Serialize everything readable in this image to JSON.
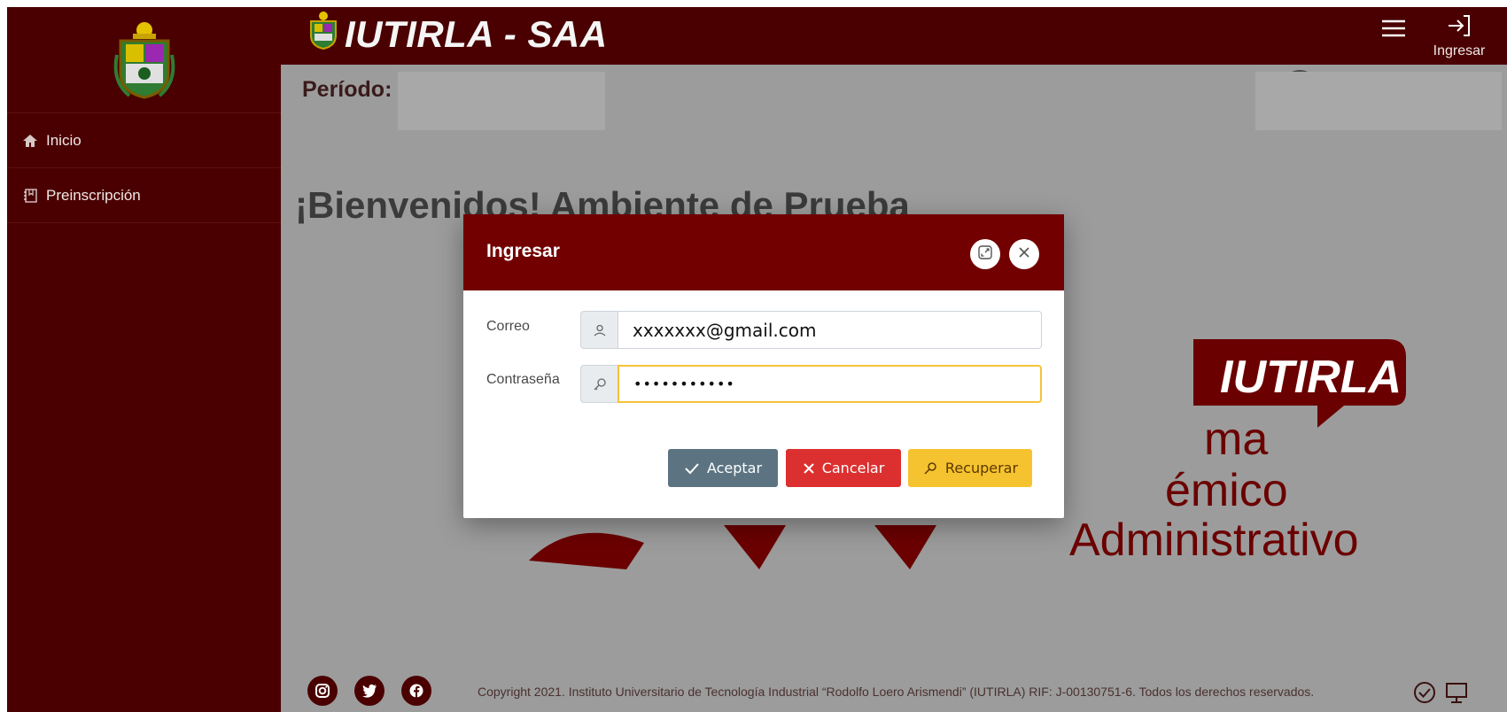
{
  "app": {
    "title": "IUTIRLA - SAA"
  },
  "topbar": {
    "login_label": "Ingresar"
  },
  "sidebar": {
    "items": [
      {
        "label": "Inicio",
        "icon": "home-icon"
      },
      {
        "label": "Preinscripción",
        "icon": "notebook-icon"
      }
    ]
  },
  "main": {
    "periodo_label": "Período:",
    "welcome": "¡Bienvenidos! Ambiente de Prueba"
  },
  "brand": {
    "name": "IUTIRLA",
    "line1": "ma",
    "line2": "émico",
    "line3": "Administrativo"
  },
  "modal": {
    "title": "Ingresar",
    "correo_label": "Correo",
    "correo_value": "xxxxxxx@gmail.com",
    "pass_label": "Contraseña",
    "pass_value": "•••••••••••",
    "accept_label": "Aceptar",
    "cancel_label": "Cancelar",
    "recover_label": "Recuperar"
  },
  "footer": {
    "copyright": "Copyright 2021. Instituto Universitario de Tecnología Industrial “Rodolfo Loero Arismendi” (IUTIRLA) RIF: J-00130751-6. Todos los derechos reservados.",
    "social": [
      "instagram-icon",
      "twitter-icon",
      "facebook-icon"
    ]
  },
  "colors": {
    "brand": "#4a0000",
    "modal_header": "#720000",
    "accept": "#5c7482",
    "cancel": "#dc3030",
    "recover": "#f6c330",
    "focus": "#f5c33b"
  }
}
